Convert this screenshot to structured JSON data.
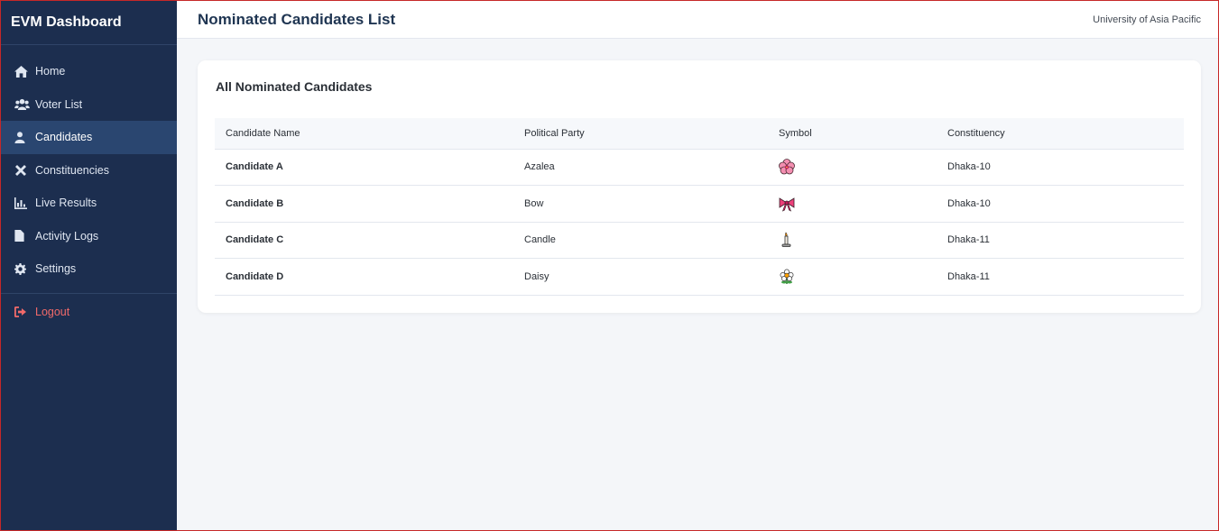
{
  "sidebar": {
    "brand": "EVM Dashboard",
    "items": [
      {
        "label": "Home",
        "icon": "home-icon"
      },
      {
        "label": "Voter List",
        "icon": "users-icon"
      },
      {
        "label": "Candidates",
        "icon": "user-icon",
        "active": true
      },
      {
        "label": "Constituencies",
        "icon": "tools-icon"
      },
      {
        "label": "Live Results",
        "icon": "chart-icon"
      },
      {
        "label": "Activity Logs",
        "icon": "file-icon"
      },
      {
        "label": "Settings",
        "icon": "gear-icon"
      }
    ],
    "logout": {
      "label": "Logout",
      "icon": "logout-icon"
    }
  },
  "header": {
    "title": "Nominated Candidates List",
    "org": "University of Asia Pacific"
  },
  "card": {
    "title": "All Nominated Candidates",
    "columns": [
      "Candidate Name",
      "Political Party",
      "Symbol",
      "Constituency"
    ],
    "rows": [
      {
        "name": "Candidate A",
        "party": "Azalea",
        "symbol": "hibiscus-icon",
        "constituency": "Dhaka-10"
      },
      {
        "name": "Candidate B",
        "party": "Bow",
        "symbol": "ribbon-icon",
        "constituency": "Dhaka-10"
      },
      {
        "name": "Candidate C",
        "party": "Candle",
        "symbol": "candle-icon",
        "constituency": "Dhaka-11"
      },
      {
        "name": "Candidate D",
        "party": "Daisy",
        "symbol": "blossom-icon",
        "constituency": "Dhaka-11"
      }
    ]
  },
  "colors": {
    "sidebar_bg": "#1c2e4f",
    "sidebar_active": "#2a4670",
    "logout": "#f16a6a",
    "title": "#1f3552",
    "frame_border": "#c62828"
  }
}
